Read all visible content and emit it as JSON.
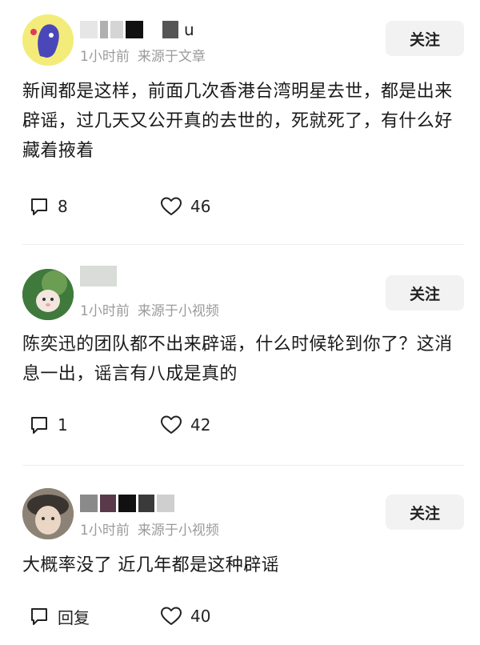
{
  "comments": [
    {
      "username_suffix": "u",
      "time": "1小时前",
      "source": "来源于文章",
      "follow_label": "关注",
      "text": "新闻都是这样，前面几次香港台湾明星去世，都是出来辟谣，过几天又公开真的去世的，死就死了，有什么好藏着掖着",
      "reply_value": "8",
      "like_count": "46",
      "avatar_bg": "#f4ec7a",
      "avatar_fg": "#4a48b8"
    },
    {
      "time": "1小时前",
      "source": "来源于小视频",
      "follow_label": "关注",
      "text": "陈奕迅的团队都不出来辟谣，什么时候轮到你了？这消息一出，谣言有八成是真的",
      "reply_value": "1",
      "like_count": "42",
      "avatar_bg": "#3f7a3c"
    },
    {
      "time": "1小时前",
      "source": "来源于小视频",
      "follow_label": "关注",
      "text": "大概率没了 近几年都是这种辟谣",
      "reply_value": "回复",
      "like_count": "40",
      "avatar_bg": "#8c8275"
    }
  ],
  "icons": {
    "reply": "comment-bubble-icon",
    "like": "heart-outline-icon"
  }
}
